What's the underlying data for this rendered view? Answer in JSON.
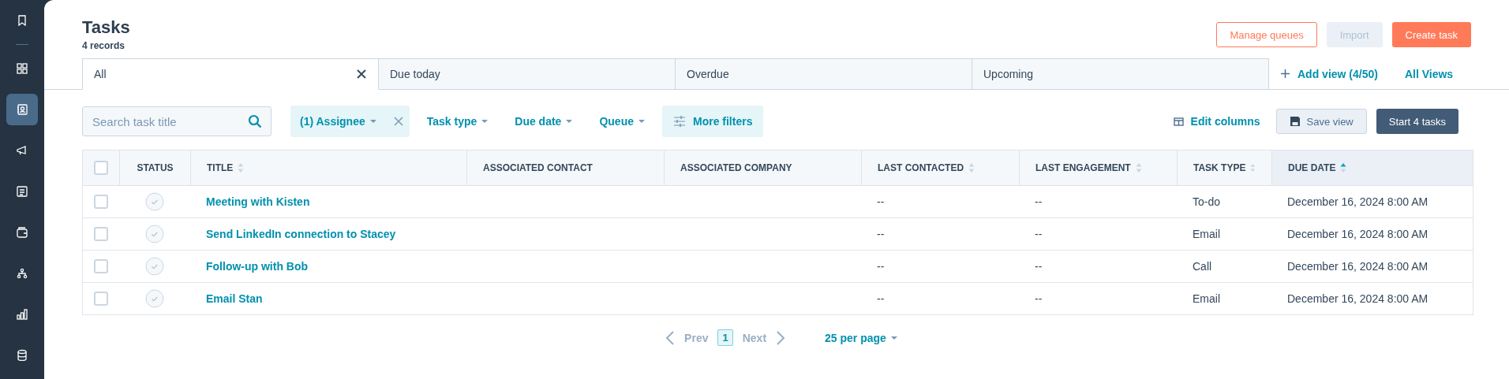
{
  "sidebar": {
    "items": [
      {
        "kind": "bookmark",
        "selected": false
      },
      {
        "kind": "grid",
        "selected": false
      },
      {
        "kind": "contacts",
        "selected": true
      },
      {
        "kind": "megaphone",
        "selected": false
      },
      {
        "kind": "document",
        "selected": false
      },
      {
        "kind": "wallet",
        "selected": false
      },
      {
        "kind": "hierarchy",
        "selected": false
      },
      {
        "kind": "chart",
        "selected": false
      },
      {
        "kind": "database",
        "selected": false
      }
    ]
  },
  "header": {
    "title": "Tasks",
    "subtitle": "4 records",
    "buttons": [
      {
        "label": "Manage queues",
        "kind": "outline"
      },
      {
        "label": "Import",
        "kind": "disabled"
      },
      {
        "label": "Create task",
        "kind": "primary"
      }
    ]
  },
  "tabs": [
    {
      "label": "All",
      "selected": true
    },
    {
      "label": "Due today",
      "selected": false
    },
    {
      "label": "Overdue",
      "selected": false
    },
    {
      "label": "Upcoming",
      "selected": false
    }
  ],
  "view_actions": {
    "add_view": "Add view (4/50)",
    "all_views": "All Views"
  },
  "filters": {
    "search": {
      "placeholder": "Search task title"
    },
    "items": [
      {
        "label": "(1) Assignee",
        "kind": "active"
      },
      {
        "label": "Task type",
        "kind": "dropdown"
      },
      {
        "label": "Due date",
        "kind": "dropdown"
      },
      {
        "label": "Queue",
        "kind": "dropdown"
      },
      {
        "label": "More filters",
        "kind": "more"
      }
    ],
    "edit_columns": "Edit columns",
    "save_view": "Save view",
    "start": "Start 4 tasks"
  },
  "table": {
    "select_all": {
      "checked": false
    },
    "columns": [
      {
        "label": "STATUS",
        "sortable": false,
        "sorted": false
      },
      {
        "label": "TITLE",
        "sortable": true,
        "sorted": false
      },
      {
        "label": "ASSOCIATED CONTACT",
        "sortable": false,
        "sorted": false
      },
      {
        "label": "ASSOCIATED COMPANY",
        "sortable": false,
        "sorted": false
      },
      {
        "label": "LAST CONTACTED",
        "sortable": true,
        "sorted": false
      },
      {
        "label": "LAST ENGAGEMENT",
        "sortable": true,
        "sorted": false
      },
      {
        "label": "TASK TYPE",
        "sortable": true,
        "sorted": false
      },
      {
        "label": "DUE DATE",
        "sortable": true,
        "sorted": true
      }
    ],
    "rows": [
      {
        "checked": false,
        "completed": false,
        "title": "Meeting with Kisten",
        "last_contacted": "--",
        "last_engagement": "--",
        "task_type": "To-do",
        "due_date": "December 16, 2024 8:00 AM"
      },
      {
        "checked": false,
        "completed": false,
        "title": "Send LinkedIn connection to Stacey",
        "last_contacted": "--",
        "last_engagement": "--",
        "task_type": "Email",
        "due_date": "December 16, 2024 8:00 AM"
      },
      {
        "checked": false,
        "completed": false,
        "title": "Follow-up with Bob",
        "last_contacted": "--",
        "last_engagement": "--",
        "task_type": "Call",
        "due_date": "December 16, 2024 8:00 AM"
      },
      {
        "checked": false,
        "completed": false,
        "title": "Email Stan",
        "last_contacted": "--",
        "last_engagement": "--",
        "task_type": "Email",
        "due_date": "December 16, 2024 8:00 AM"
      }
    ]
  },
  "pagination": {
    "prev": "Prev",
    "page": "1",
    "next": "Next",
    "per_page": "25 per page"
  }
}
